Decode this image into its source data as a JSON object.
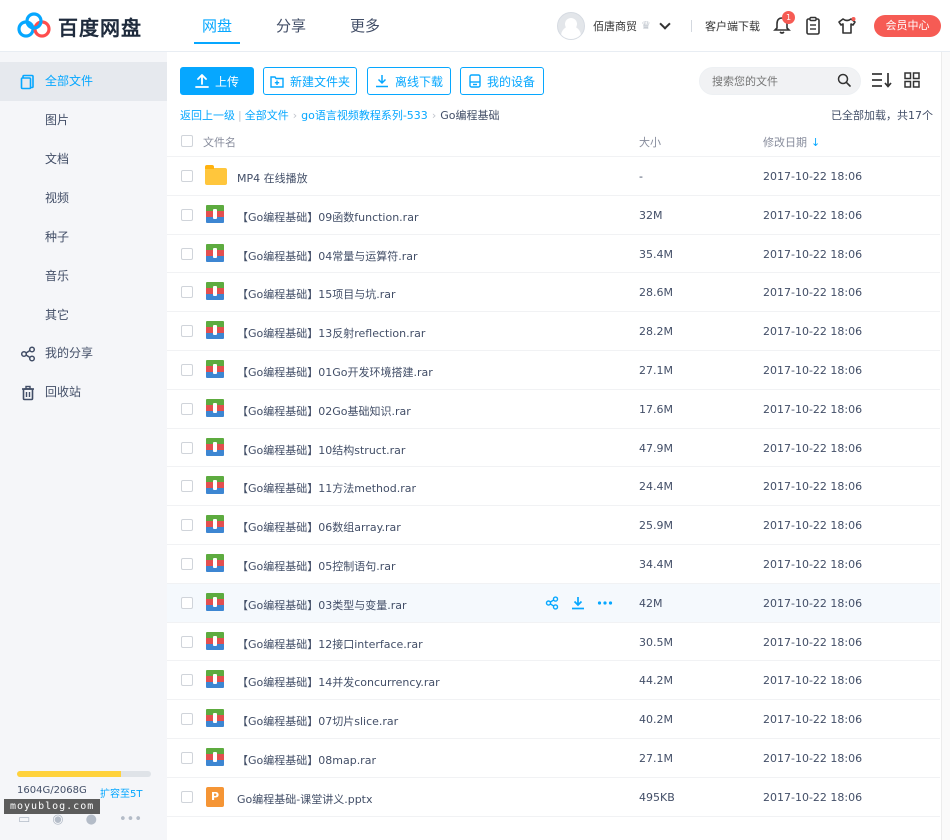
{
  "brand": {
    "name": "百度网盘"
  },
  "nav": {
    "items": [
      {
        "label": "网盘"
      },
      {
        "label": "分享"
      },
      {
        "label": "更多"
      }
    ]
  },
  "header": {
    "username": "佰唐商贸",
    "client_download": "客户端下载",
    "notification_count": "1",
    "vip_label": "会员中心"
  },
  "sidebar": {
    "items": [
      {
        "label": "全部文件"
      },
      {
        "label": "图片"
      },
      {
        "label": "文档"
      },
      {
        "label": "视频"
      },
      {
        "label": "种子"
      },
      {
        "label": "音乐"
      },
      {
        "label": "其它"
      },
      {
        "label": "我的分享"
      },
      {
        "label": "回收站"
      }
    ],
    "quota": {
      "text": "1604G/2068G",
      "upgrade": "扩容至5T",
      "used_fraction": 0.776
    },
    "watermark": "moyublog.com"
  },
  "toolbar": {
    "upload": "上传",
    "new_folder": "新建文件夹",
    "offline_download": "离线下载",
    "my_devices": "我的设备",
    "search_placeholder": "搜索您的文件"
  },
  "breadcrumb": {
    "back": "返回上一级",
    "all_files": "全部文件",
    "parent": "go语言视频教程系列-533",
    "current": "Go编程基础"
  },
  "loaded_info": "已全部加载，共17个",
  "table": {
    "headers": {
      "name": "文件名",
      "size": "大小",
      "date": "修改日期"
    },
    "rows": [
      {
        "type": "folder",
        "name": "MP4 在线播放",
        "size": "-",
        "date": "2017-10-22 18:06"
      },
      {
        "type": "rar",
        "name": "【Go编程基础】09函数function.rar",
        "size": "32M",
        "date": "2017-10-22 18:06"
      },
      {
        "type": "rar",
        "name": "【Go编程基础】04常量与运算符.rar",
        "size": "35.4M",
        "date": "2017-10-22 18:06"
      },
      {
        "type": "rar",
        "name": "【Go编程基础】15项目与坑.rar",
        "size": "28.6M",
        "date": "2017-10-22 18:06"
      },
      {
        "type": "rar",
        "name": "【Go编程基础】13反射reflection.rar",
        "size": "28.2M",
        "date": "2017-10-22 18:06"
      },
      {
        "type": "rar",
        "name": "【Go编程基础】01Go开发环境搭建.rar",
        "size": "27.1M",
        "date": "2017-10-22 18:06"
      },
      {
        "type": "rar",
        "name": "【Go编程基础】02Go基础知识.rar",
        "size": "17.6M",
        "date": "2017-10-22 18:06"
      },
      {
        "type": "rar",
        "name": "【Go编程基础】10结构struct.rar",
        "size": "47.9M",
        "date": "2017-10-22 18:06"
      },
      {
        "type": "rar",
        "name": "【Go编程基础】11方法method.rar",
        "size": "24.4M",
        "date": "2017-10-22 18:06"
      },
      {
        "type": "rar",
        "name": "【Go编程基础】06数组array.rar",
        "size": "25.9M",
        "date": "2017-10-22 18:06"
      },
      {
        "type": "rar",
        "name": "【Go编程基础】05控制语句.rar",
        "size": "34.4M",
        "date": "2017-10-22 18:06"
      },
      {
        "type": "rar",
        "name": "【Go编程基础】03类型与变量.rar",
        "size": "42M",
        "date": "2017-10-22 18:06",
        "hover": true
      },
      {
        "type": "rar",
        "name": "【Go编程基础】12接口interface.rar",
        "size": "30.5M",
        "date": "2017-10-22 18:06"
      },
      {
        "type": "rar",
        "name": "【Go编程基础】14并发concurrency.rar",
        "size": "44.2M",
        "date": "2017-10-22 18:06"
      },
      {
        "type": "rar",
        "name": "【Go编程基础】07切片slice.rar",
        "size": "40.2M",
        "date": "2017-10-22 18:06"
      },
      {
        "type": "rar",
        "name": "【Go编程基础】08map.rar",
        "size": "27.1M",
        "date": "2017-10-22 18:06"
      },
      {
        "type": "ppt",
        "name": "Go编程基础-课堂讲义.pptx",
        "size": "495KB",
        "date": "2017-10-22 18:06"
      }
    ]
  },
  "colors": {
    "accent": "#06a7ff",
    "vip": "#f65b54",
    "quota": "#ffd23c"
  },
  "icons": {
    "sidebar": [
      "files-icon",
      "",
      "",
      "",
      "",
      "",
      "",
      "share-icon",
      "trash-icon"
    ],
    "row_actions": [
      "share-icon",
      "download-icon",
      "more-icon"
    ]
  }
}
